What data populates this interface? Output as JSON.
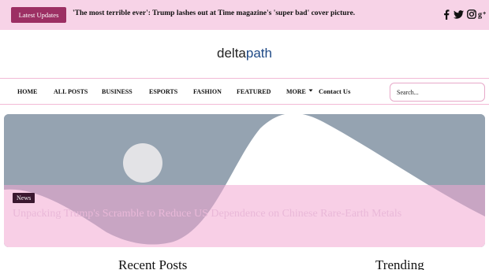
{
  "topbar": {
    "updates_label": "Latest Updates",
    "ticker_text": "'The most terrible ever': Trump lashes out at Time magazine's 'super bad' cover picture."
  },
  "social_icons": [
    "facebook-icon",
    "twitter-icon",
    "instagram-icon",
    "google-plus-icon"
  ],
  "brand": {
    "part1": "delta",
    "part2": "path"
  },
  "nav": {
    "items": [
      "HOME",
      "ALL POSTS",
      "BUSINESS",
      "ESPORTS",
      "FASHION",
      "FEATURED",
      "MORE",
      "Contact Us"
    ],
    "search_placeholder": "Search..."
  },
  "hero": {
    "tag": "News",
    "title": "Unpacking Trump's Scramble to Reduce US Dependence on Chinese Rare-Earth Metals"
  },
  "sections": {
    "recent": "Recent Posts",
    "trending": "Trending"
  },
  "colors": {
    "topbar_bg": "#f7d3e7",
    "accent": "#9c2f63",
    "brand_blue": "#1f4a86",
    "hero_bg": "#95a3b1"
  }
}
